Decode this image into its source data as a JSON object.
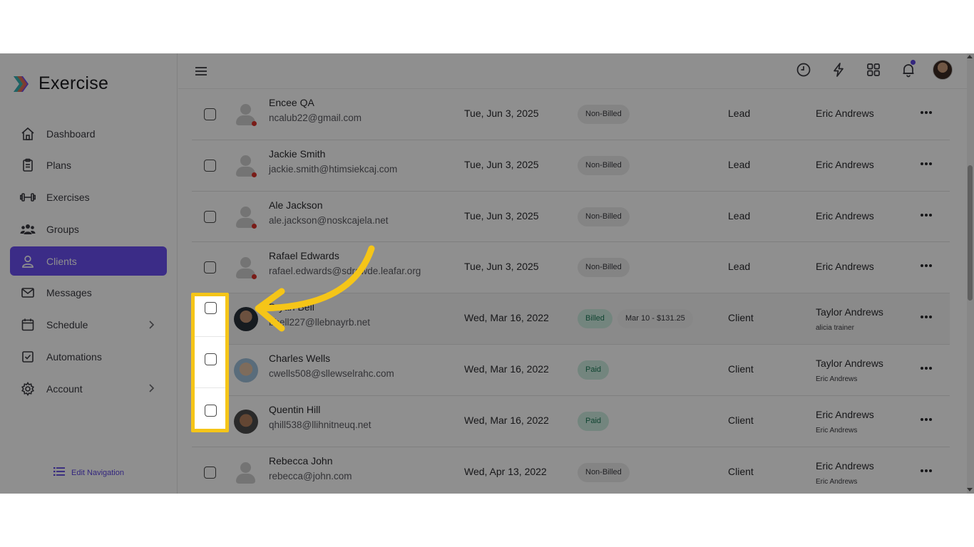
{
  "app": {
    "name": "Exercise"
  },
  "sidebar": {
    "items": [
      {
        "label": "Dashboard",
        "icon": "home-icon",
        "active": false
      },
      {
        "label": "Plans",
        "icon": "clipboard-icon",
        "active": false
      },
      {
        "label": "Exercises",
        "icon": "dumbbell-icon",
        "active": false
      },
      {
        "label": "Groups",
        "icon": "users-icon",
        "active": false
      },
      {
        "label": "Clients",
        "icon": "user-icon",
        "active": true
      },
      {
        "label": "Messages",
        "icon": "envelope-icon",
        "active": false
      },
      {
        "label": "Schedule",
        "icon": "calendar-icon",
        "active": false,
        "expandable": true
      },
      {
        "label": "Automations",
        "icon": "checkbox-icon",
        "active": false
      },
      {
        "label": "Account",
        "icon": "gear-icon",
        "active": false,
        "expandable": true
      }
    ],
    "edit_nav_label": "Edit Navigation"
  },
  "topbar": {
    "icons": [
      "menu-icon",
      "clock-icon",
      "lightning-icon",
      "apps-grid-icon",
      "bell-icon",
      "user-avatar"
    ]
  },
  "clients": [
    {
      "name": "Encee QA",
      "email": "ncalub22@gmail.com",
      "date": "Tue, Jun 3, 2025",
      "status": "Non-Billed",
      "type": "Lead",
      "trainer": "Eric Andrews",
      "avatar": "placeholder",
      "online": false
    },
    {
      "name": "Jackie Smith",
      "email": "jackie.smith@htimsiekcaj.com",
      "date": "Tue, Jun 3, 2025",
      "status": "Non-Billed",
      "type": "Lead",
      "trainer": "Eric Andrews",
      "avatar": "placeholder",
      "online": false
    },
    {
      "name": "Ale Jackson",
      "email": "ale.jackson@noskcajela.net",
      "date": "Tue, Jun 3, 2025",
      "status": "Non-Billed",
      "type": "Lead",
      "trainer": "Eric Andrews",
      "avatar": "placeholder",
      "online": false
    },
    {
      "name": "Rafael Edwards",
      "email": "rafael.edwards@sdrawde.leafar.org",
      "date": "Tue, Jun 3, 2025",
      "status": "Non-Billed",
      "type": "Lead",
      "trainer": "Eric Andrews",
      "avatar": "placeholder",
      "online": false
    },
    {
      "name": "Bryan Bell",
      "email": "bbell227@llebnayrb.net",
      "date": "Wed, Mar 16, 2022",
      "status": "Billed",
      "amount": "Mar 10 - $131.25",
      "type": "Client",
      "trainer": "Taylor Andrews",
      "trainer_sub": "alicia trainer",
      "avatar": "photo1"
    },
    {
      "name": "Charles Wells",
      "email": "cwells508@sllewselrahc.com",
      "date": "Wed, Mar 16, 2022",
      "status": "Paid",
      "type": "Client",
      "trainer": "Taylor Andrews",
      "trainer_sub": "Eric Andrews",
      "avatar": "photo2"
    },
    {
      "name": "Quentin Hill",
      "email": "qhill538@llihnitneuq.net",
      "date": "Wed, Mar 16, 2022",
      "status": "Paid",
      "type": "Client",
      "trainer": "Eric Andrews",
      "trainer_sub": "Eric Andrews",
      "avatar": "photo3"
    },
    {
      "name": "Rebecca John",
      "email": "rebecca@john.com",
      "date": "Wed, Apr 13, 2022",
      "status": "Non-Billed",
      "type": "Client",
      "trainer": "Eric Andrews",
      "trainer_sub": "Eric Andrews",
      "avatar": "placeholder"
    }
  ],
  "colors": {
    "accent": "#6a4ff0",
    "highlight": "#f5c518",
    "paid": "#cdeee0",
    "offline_dot": "#d9332b"
  }
}
